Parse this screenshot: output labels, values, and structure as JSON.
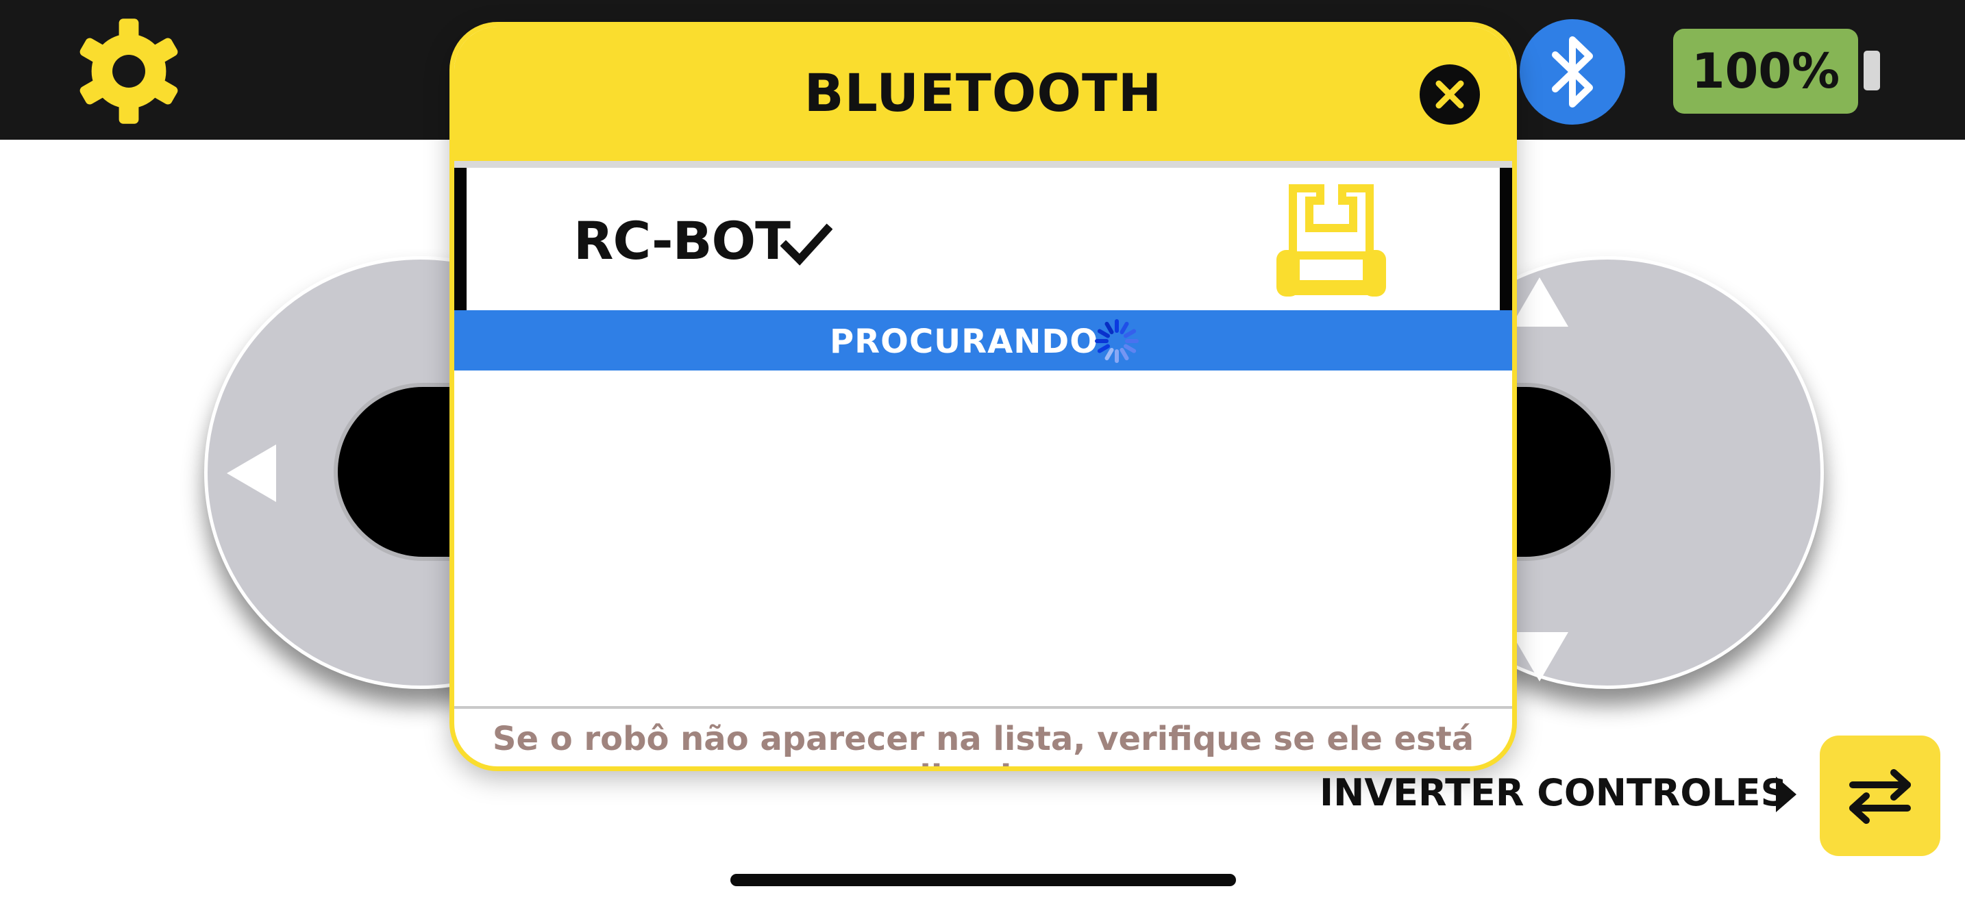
{
  "topbar": {
    "settings_icon": "gear-icon",
    "bluetooth_icon": "bluetooth-icon",
    "battery": {
      "label": "100%",
      "level": 1.0,
      "color": "#86b555"
    }
  },
  "controls": {
    "left_pad_icon": "triangle-left-icon",
    "right_pad_up_icon": "triangle-up-icon",
    "right_pad_down_icon": "triangle-down-icon",
    "invert_label": "INVERTER CONTROLES",
    "invert_icon": "swap-arrows-icon"
  },
  "modal": {
    "title": "BLUETOOTH",
    "close_icon": "close-icon",
    "devices": [
      {
        "name": "RC-BOT",
        "connected": true,
        "icon": "robot-icon"
      }
    ],
    "status": "PROCURANDO",
    "status_icon": "spinner-icon",
    "footer": "Se o robô não aparecer na lista, verifique se ele está ligado."
  },
  "colors": {
    "accent_yellow": "#fadd2e",
    "accent_blue": "#2f7fe6",
    "topbar": "#171717"
  }
}
